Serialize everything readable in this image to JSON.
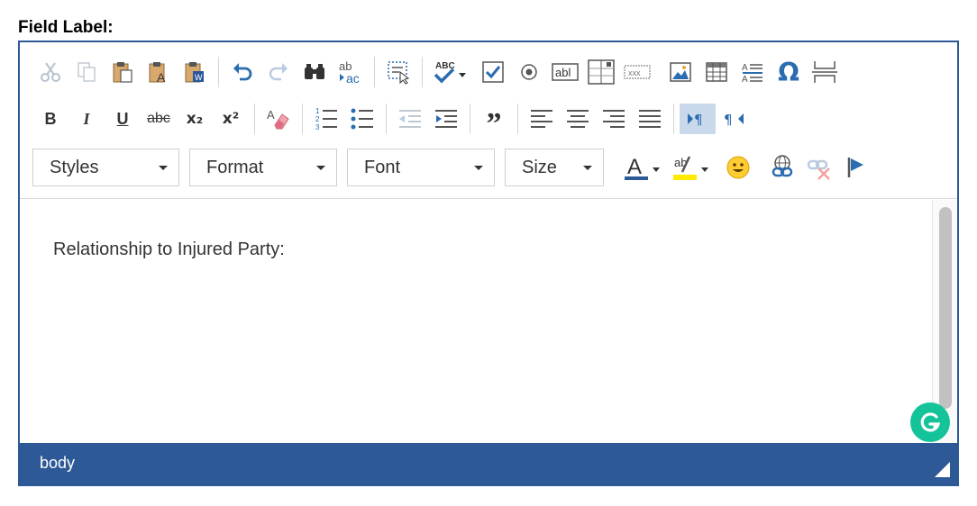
{
  "field_label": "Field Label:",
  "toolbar": {
    "styles_label": "Styles",
    "format_label": "Format",
    "font_label": "Font",
    "size_label": "Size",
    "strike_glyph": "abc",
    "superscript_glyph": "x²",
    "subscript_glyph": "x₂",
    "spell_glyph": "ABC",
    "replace_glyph_top": "ab",
    "replace_glyph_bottom": "ac",
    "textfield_glyph": "abl",
    "hidden_glyph": "xxx",
    "omega_glyph": "Ω",
    "highlight_glyph": "ab"
  },
  "content": {
    "text": "Relationship to Injured Party:"
  },
  "statusbar": {
    "path": "body"
  },
  "colors": {
    "frame": "#2d5a97",
    "grammarly": "#15c39a",
    "icon_blue": "#2b6cb0",
    "highlight_yellow": "#ffeb00"
  }
}
